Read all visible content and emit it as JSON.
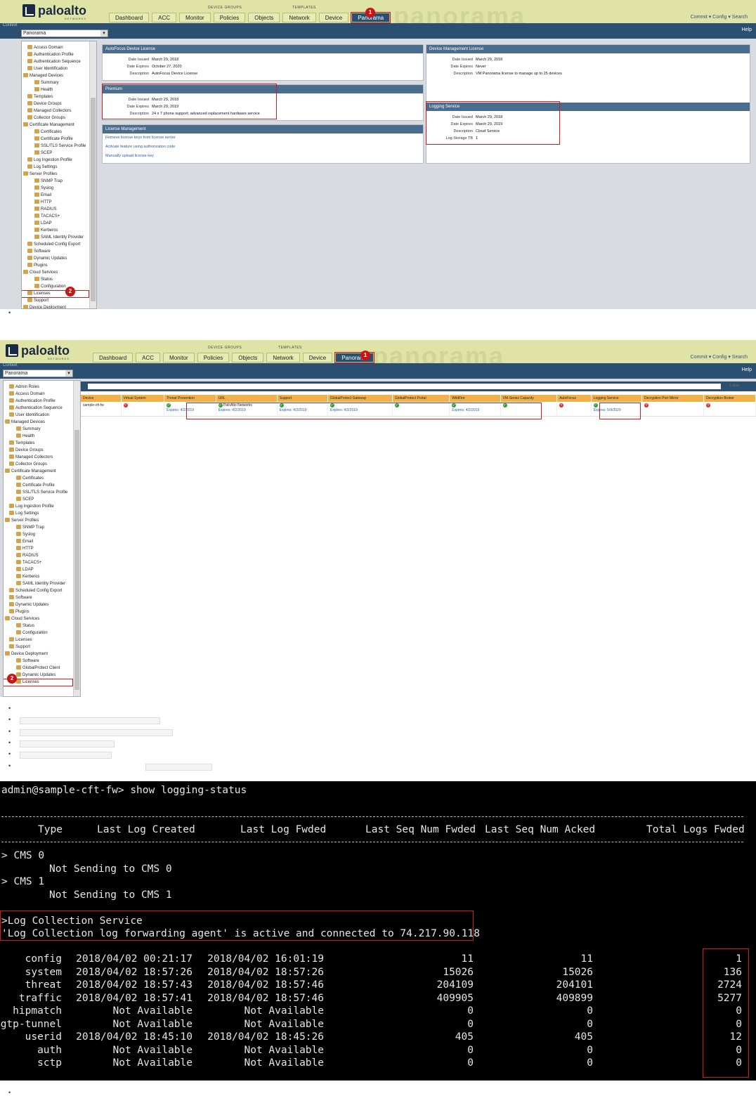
{
  "screenshot1": {
    "logo": {
      "name": "paloalto",
      "sub": "NETWORKS"
    },
    "watermark": "panorama",
    "group_labels": {
      "device_groups": "DEVICE GROUPS",
      "templates": "TEMPLATES"
    },
    "tabs": [
      "Dashboard",
      "ACC",
      "Monitor",
      "Policies",
      "Objects",
      "Network",
      "Device",
      "Panorama"
    ],
    "top_right": "Commit ▾  Config ▾  Search",
    "context_label": "Context",
    "context_value": "Panorama",
    "help": "Help",
    "callouts": {
      "one": "1",
      "two": "2"
    },
    "sidebar": [
      "Access Domain",
      "Authentication Profile",
      "Authentication Sequence",
      "User Identification",
      "Managed Devices",
      "Summary",
      "Health",
      "Templates",
      "Device Groups",
      "Managed Collectors",
      "Collector Groups",
      "Certificate Management",
      "Certificates",
      "Certificate Profile",
      "SSL/TLS Service Profile",
      "SCEP",
      "Log Ingestion Profile",
      "Log Settings",
      "Server Profiles",
      "SNMP Trap",
      "Syslog",
      "Email",
      "HTTP",
      "RADIUS",
      "TACACS+",
      "LDAP",
      "Kerberos",
      "SAML Identity Provider",
      "Scheduled Config Export",
      "Software",
      "Dynamic Updates",
      "Plugins",
      "Cloud Services",
      "Status",
      "Configuration",
      "Licenses",
      "Support",
      "Device Deployment"
    ],
    "autofocus": {
      "title": "AutoFocus Device License",
      "rows": [
        [
          "Date Issued",
          "March 29, 2018"
        ],
        [
          "Date Expires",
          "October 27, 2020"
        ],
        [
          "Description",
          "AutoFocus Device License"
        ]
      ]
    },
    "premium": {
      "title": "Premium",
      "rows": [
        [
          "Date Issued",
          "March 29, 2018"
        ],
        [
          "Date Expires",
          "March 29, 2019"
        ],
        [
          "Description",
          "24 x 7 phone support; advanced replacement hardware service"
        ]
      ]
    },
    "license_mgmt": {
      "title": "License Management",
      "links": [
        "Retrieve license keys from license server",
        "Activate feature using authorization code",
        "Manually upload license key"
      ]
    },
    "device_mgmt": {
      "title": "Device Management License",
      "rows": [
        [
          "Date Issued",
          "March 29, 2018"
        ],
        [
          "Date Expires",
          "Never"
        ],
        [
          "Description",
          "VM Panorama license to manage up to 25 devices"
        ]
      ]
    },
    "logging": {
      "title": "Logging Service",
      "rows": [
        [
          "Date Issued",
          "March 29, 2018"
        ],
        [
          "Date Expires",
          "March 29, 2019"
        ],
        [
          "Description",
          "Cloud Service"
        ],
        [
          "Log Storage TB",
          "1"
        ]
      ]
    }
  },
  "screenshot2": {
    "sidebar": [
      "Admin Roles",
      "Access Domain",
      "Authentication Profile",
      "Authentication Sequence",
      "User Identification",
      "Managed Devices",
      "Summary",
      "Health",
      "Templates",
      "Device Groups",
      "Managed Collectors",
      "Collector Groups",
      "Certificate Management",
      "Certificates",
      "Certificate Profile",
      "SSL/TLS Service Profile",
      "SCEP",
      "Log Ingestion Profile",
      "Log Settings",
      "Server Profiles",
      "SNMP Trap",
      "Syslog",
      "Email",
      "HTTP",
      "RADIUS",
      "TACACS+",
      "LDAP",
      "Kerberos",
      "SAML Identity Provider",
      "Scheduled Config Export",
      "Software",
      "Dynamic Updates",
      "Plugins",
      "Cloud Services",
      "Status",
      "Configuration",
      "Licenses",
      "Support",
      "Device Deployment",
      "Software",
      "GlobalProtect Client",
      "Dynamic Updates",
      "Licenses"
    ],
    "items_count": "1 item",
    "columns": [
      "Device",
      "Virtual System",
      "Threat Prevention",
      "URL",
      "Support",
      "GlobalProtect Gateway",
      "GlobalProtect Portal",
      "WildFire",
      "VM-Series Capacity",
      "AutoFocus",
      "Logging Service",
      "Decryption Port Mirror",
      "Decryption Broker"
    ],
    "row": {
      "device": "sample-cft-fw",
      "url_label": "PaloAlto Networks",
      "threat_exp": "Expires: 4/2/2019",
      "url_exp": "Expires: 4/2/2019",
      "support_exp": "Expires: 4/2/2019",
      "gpg_exp": "Expires: 4/2/2019",
      "wildfire_exp": "Expires: 4/2/2019",
      "logging_exp": "Expires: 5/9/2020"
    }
  },
  "terminal": {
    "prompt": "admin@sample-cft-fw> show logging-status",
    "headers": [
      "Type",
      "Last Log Created",
      "Last Log Fwded",
      "Last Seq Num Fwded",
      "Last Seq Num Acked",
      "Total Logs Fwded"
    ],
    "cms0": "> CMS 0",
    "cms0_msg": "Not Sending to CMS 0",
    "cms1": "> CMS 1",
    "cms1_msg": "Not Sending to CMS 1",
    "lcs": ">Log Collection Service",
    "lcs_msg": "'Log Collection log forwarding agent' is active and connected to 74.217.90.118",
    "rows": [
      [
        "config",
        "2018/04/02 00:21:17",
        "2018/04/02 16:01:19",
        "11",
        "11",
        "1"
      ],
      [
        "system",
        "2018/04/02 18:57:26",
        "2018/04/02 18:57:26",
        "15026",
        "15026",
        "136"
      ],
      [
        "threat",
        "2018/04/02 18:57:43",
        "2018/04/02 18:57:46",
        "204109",
        "204101",
        "2724"
      ],
      [
        "traffic",
        "2018/04/02 18:57:41",
        "2018/04/02 18:57:46",
        "409905",
        "409899",
        "5277"
      ],
      [
        "hipmatch",
        "Not Available",
        "Not Available",
        "0",
        "0",
        "0"
      ],
      [
        "gtp-tunnel",
        "Not Available",
        "Not Available",
        "0",
        "0",
        "0"
      ],
      [
        "userid",
        "2018/04/02 18:45:10",
        "2018/04/02 18:45:26",
        "405",
        "405",
        "12"
      ],
      [
        "auth",
        "Not Available",
        "Not Available",
        "0",
        "0",
        "0"
      ],
      [
        "sctp",
        "Not Available",
        "Not Available",
        "0",
        "0",
        "0"
      ]
    ]
  }
}
